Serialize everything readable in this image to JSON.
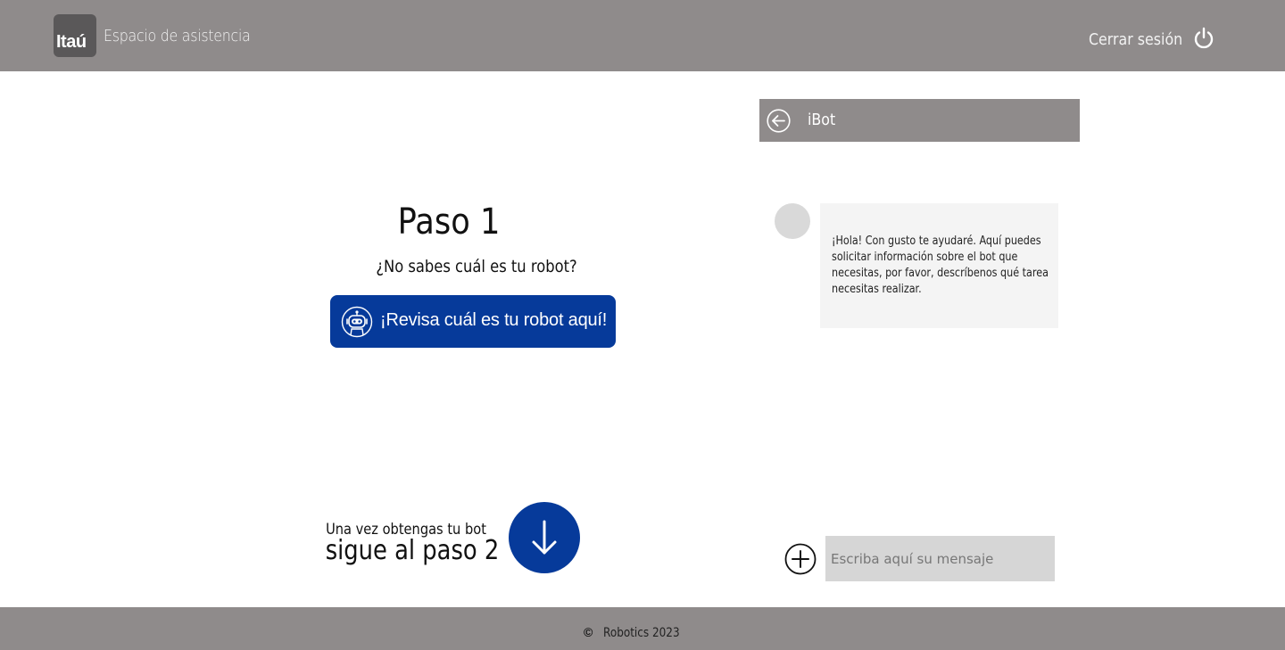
{
  "header": {
    "logo_text": "Itaú",
    "app_title": "Espacio de asistencia",
    "logout_label": "Cerrar sesión",
    "power_icon": "power-icon"
  },
  "main": {
    "step_title": "Paso 1",
    "question": "¿No sabes cuál es tu robot?",
    "robot_button_label": "¡Revisa cuál es tu robot aquí!",
    "robot_icon": "robot-icon",
    "next_small": "Una vez obtengas tu bot",
    "next_big": "sigue al paso 2",
    "down_icon": "arrow-down-icon"
  },
  "chat": {
    "title": "iBot",
    "back_icon": "arrow-left-circle-icon",
    "bot_message": "¡Hola! Con gusto te ayudaré. Aquí puedes solicitar información sobre el bot que necesitas, por favor, descríbenos qué tarea necesitas realizar.",
    "input_placeholder": "Escriba aquí su mensaje",
    "add_icon": "plus-circle-icon"
  },
  "footer": {
    "copyright_symbol": "©",
    "text": "Robotics 2023"
  },
  "colors": {
    "header_bg": "#8f8b8b",
    "accent_blue": "#063a9a",
    "bubble_bg": "#f4f4f4",
    "input_bg": "#d6d6d6"
  }
}
